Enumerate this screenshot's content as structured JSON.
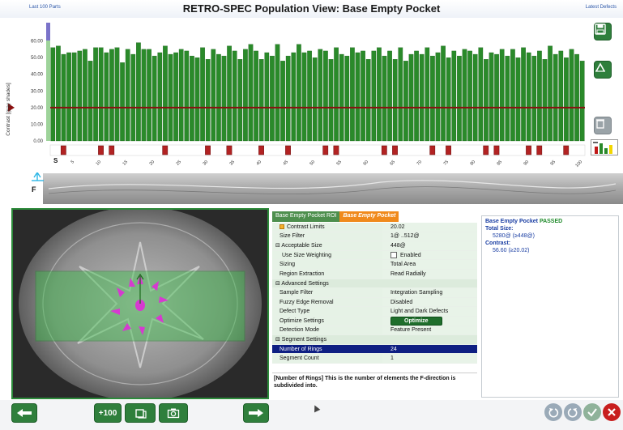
{
  "header": {
    "left_link": "Last 100 Parts",
    "title": "RETRO-SPEC Population View:  Base Empty Pocket",
    "right_link": "Latest Defects"
  },
  "chart_data": {
    "type": "bar",
    "ylabel": "Contrast [gray shades]",
    "ylim": [
      0,
      70
    ],
    "y_ticks": [
      "60.00",
      "50.00",
      "40.00",
      "30.00",
      "20.00",
      "10.00",
      "0.00"
    ],
    "x_ticks": [
      "5",
      "10",
      "15",
      "20",
      "25",
      "30",
      "35",
      "40",
      "45",
      "50",
      "55",
      "60",
      "65",
      "70",
      "75",
      "80",
      "85",
      "90",
      "95",
      "100"
    ],
    "start_label": "S",
    "threshold": 20.02,
    "values": [
      56,
      57,
      52,
      53,
      53,
      54,
      55,
      48,
      56,
      56,
      53,
      55,
      56,
      47,
      55,
      52,
      59,
      55,
      55,
      51,
      53,
      57,
      52,
      53,
      55,
      54,
      51,
      50,
      56,
      49,
      55,
      52,
      51,
      57,
      54,
      49,
      55,
      58,
      54,
      49,
      53,
      51,
      58,
      48,
      51,
      53,
      58,
      53,
      54,
      50,
      55,
      54,
      49,
      56,
      52,
      51,
      56,
      53,
      54,
      49,
      54,
      56,
      51,
      54,
      49,
      56,
      48,
      52,
      54,
      52,
      56,
      51,
      53,
      57,
      50,
      54,
      51,
      55,
      54,
      52,
      56,
      49,
      53,
      52,
      55,
      51,
      55,
      50,
      56,
      53,
      51,
      54,
      49,
      57,
      52,
      54,
      50,
      55,
      52,
      48
    ],
    "defect_positions": [
      3,
      10,
      12,
      22,
      30,
      34,
      40,
      45,
      52,
      54,
      63,
      65,
      72,
      75,
      82,
      84,
      90,
      92,
      97
    ]
  },
  "colors": {
    "bar": "#2a8a2a",
    "threshold": "#8a1010",
    "defect": "#b22222",
    "accent_green": "#2f7f3c",
    "selected_row": "#0e1f82",
    "tab_active": "#f08a1c"
  },
  "icons": {
    "save": "floppy-disk-icon",
    "chart_toggle": "graph-icon",
    "delete": "trash-icon",
    "legend": "histogram-icon"
  },
  "strip": {
    "axis_f": "F"
  },
  "tabs": [
    {
      "label": "Base Empty Pocket ROI"
    },
    {
      "label": "Base Empty Pocket"
    }
  ],
  "settings": {
    "rows": [
      {
        "key": "Contrast Limits",
        "value": "20.02",
        "flag": true
      },
      {
        "key": "Size Filter",
        "value": "1@ ..512@"
      },
      {
        "key": "⊟ Acceptable Size",
        "value": "448@"
      },
      {
        "key": "Use Size Weighting",
        "value": "Enabled",
        "checkbox": true
      },
      {
        "key": "Sizing",
        "value": "Total Area"
      },
      {
        "key": "Region Extraction",
        "value": "Read Radially"
      },
      {
        "key": "⊟ Advanced Settings",
        "value": "",
        "section": true
      },
      {
        "key": "Sample Filter",
        "value": "Integration Sampling"
      },
      {
        "key": "Fuzzy Edge Removal",
        "value": "Disabled"
      },
      {
        "key": "Defect Type",
        "value": "Light and Dark Defects"
      },
      {
        "key": "Optimize Settings",
        "value": "Optimize",
        "button": true
      },
      {
        "key": "Detection Mode",
        "value": "Feature Present"
      },
      {
        "key": "⊟ Segment Settings",
        "value": "",
        "section": true
      },
      {
        "key": "Number of Rings",
        "value": "24",
        "selected": true
      },
      {
        "key": "Segment Count",
        "value": "1"
      }
    ],
    "help": "[Number of Rings] This is the number of elements the F-direction is subdivided into."
  },
  "results": {
    "name": "Base Empty Pocket",
    "status": "PASSED",
    "size_label": "Total Size:",
    "size_value": "5280@ (≥448@)",
    "contrast_label": "Contrast:",
    "contrast_value": "56.60 (≥20.02)"
  },
  "bottom": {
    "plus_label": "+100"
  }
}
